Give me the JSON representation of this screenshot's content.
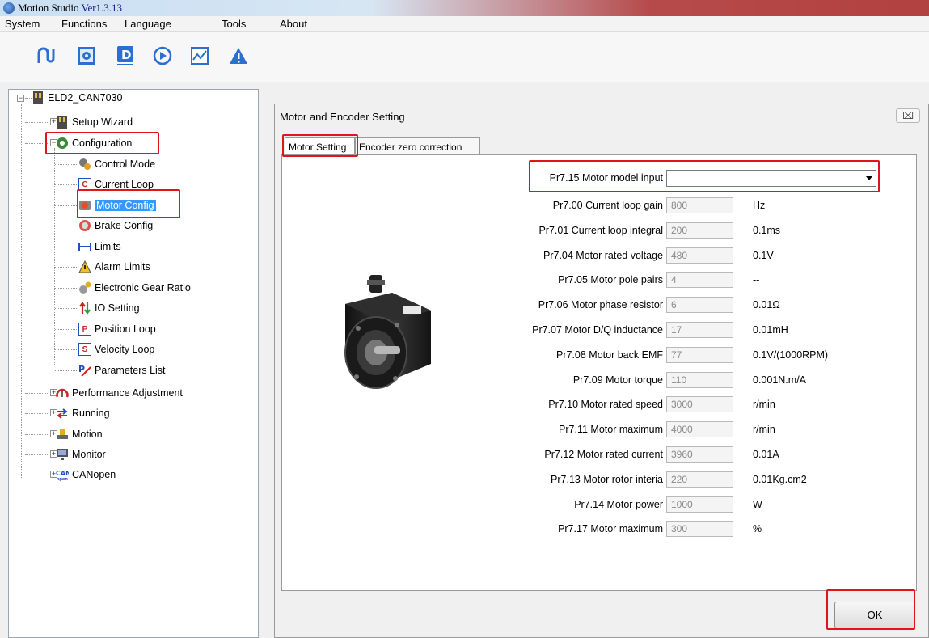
{
  "window": {
    "title": "Motion Studio ",
    "version": "Ver1.3.13"
  },
  "menu": [
    "System",
    "Functions",
    "Language",
    "Tools",
    "About"
  ],
  "toolbar_icons": [
    "connect-icon",
    "settings-icon",
    "parameter-icon",
    "run-icon",
    "scope-icon",
    "alarm-icon"
  ],
  "tree": {
    "root": "ELD2_CAN7030",
    "setup_wizard": "Setup Wizard",
    "configuration": "Configuration",
    "children": [
      "Control Mode",
      "Current Loop",
      "Motor Config",
      "Brake Config",
      "Limits",
      "Alarm Limits",
      "Electronic Gear Ratio",
      "IO Setting",
      "Position Loop",
      "Velocity Loop",
      "Parameters List"
    ],
    "groups": [
      "Performance Adjustment",
      "Running",
      "Motion",
      "Monitor",
      "CANopen"
    ]
  },
  "dialog": {
    "title": "Motor and Encoder Setting",
    "close": "⌧",
    "tabs": [
      "Motor Setting",
      "Encoder zero correction"
    ],
    "model_label": "Pr7.15 Motor model input",
    "model_value": "",
    "params": [
      {
        "label": "Pr7.00 Current loop gain",
        "value": "800",
        "unit": "Hz"
      },
      {
        "label": "Pr7.01 Current loop integral",
        "value": "200",
        "unit": "0.1ms"
      },
      {
        "label": "Pr7.04 Motor rated voltage",
        "value": "480",
        "unit": "0.1V"
      },
      {
        "label": "Pr7.05 Motor pole pairs",
        "value": "4",
        "unit": "--"
      },
      {
        "label": "Pr7.06 Motor phase resistor",
        "value": "6",
        "unit": "0.01Ω"
      },
      {
        "label": "Pr7.07 Motor D/Q inductance",
        "value": "17",
        "unit": "0.01mH"
      },
      {
        "label": "Pr7.08 Motor back EMF",
        "value": "77",
        "unit": "0.1V/(1000RPM)"
      },
      {
        "label": "Pr7.09 Motor torque",
        "value": "110",
        "unit": "0.001N.m/A"
      },
      {
        "label": "Pr7.10 Motor rated speed",
        "value": "3000",
        "unit": "r/min"
      },
      {
        "label": "Pr7.11 Motor maximum",
        "value": "4000",
        "unit": "r/min"
      },
      {
        "label": "Pr7.12 Motor rated current",
        "value": "3960",
        "unit": "0.01A"
      },
      {
        "label": "Pr7.13 Motor rotor interia",
        "value": "220",
        "unit": "0.01Kg.cm2"
      },
      {
        "label": "Pr7.14 Motor power",
        "value": "1000",
        "unit": "W"
      },
      {
        "label": "Pr7.17 Motor maximum",
        "value": "300",
        "unit": "%"
      }
    ],
    "ok_label": "OK"
  },
  "colors": {
    "highlight": "#e0141c",
    "selection": "#3399ff"
  }
}
